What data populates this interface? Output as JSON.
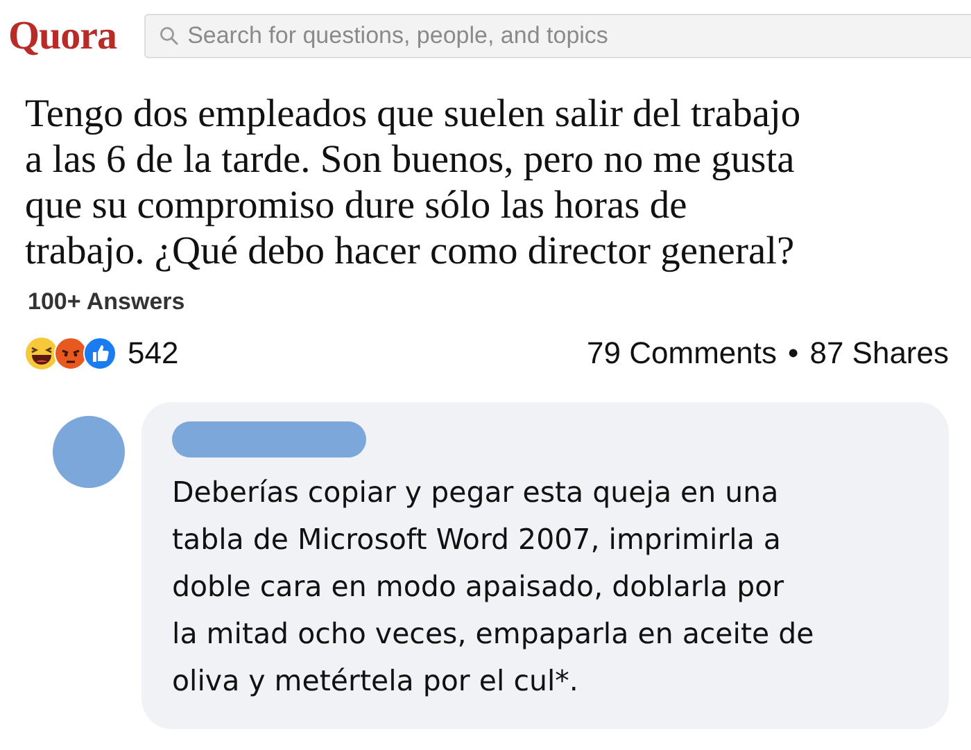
{
  "header": {
    "logo": "Quora",
    "search": {
      "placeholder": "Search for questions, people, and topics"
    }
  },
  "question": {
    "title": "Tengo dos empleados que suelen salir del trabajo\na las 6 de la tarde. Son buenos, pero no me gusta\nque su compromiso dure sólo las horas de\ntrabajo. ¿Qué debo hacer como director general?",
    "answers": "100+ Answers"
  },
  "post_stats": {
    "reactions_count": "542",
    "comments": "79 Comments",
    "separator": "•",
    "shares": "87 Shares"
  },
  "comment": {
    "text": "Deberías copiar y pegar esta queja en una\ntabla de Microsoft Word 2007, imprimirla a\ndoble cara en modo apaisado, doblarla por\nla mitad ocho veces, empaparla en aceite de\noliva y metértela por el cul*."
  }
}
